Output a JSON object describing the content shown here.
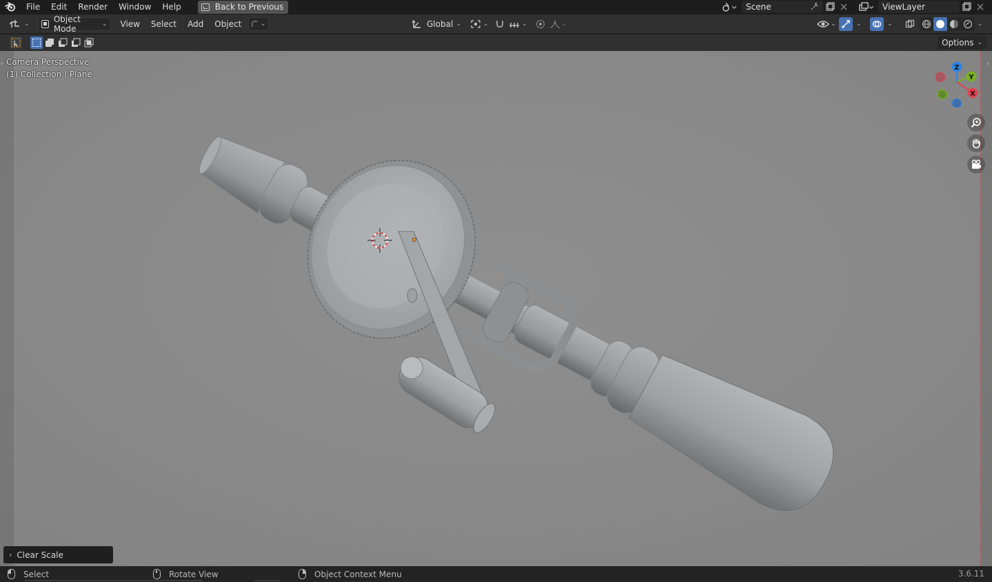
{
  "menubar": {
    "items": [
      "File",
      "Edit",
      "Render",
      "Window",
      "Help"
    ],
    "back_button": "Back to Previous",
    "scene": "Scene",
    "view_layer": "ViewLayer"
  },
  "header": {
    "mode": "Object Mode",
    "menus": [
      "View",
      "Select",
      "Add",
      "Object"
    ],
    "transform_orientation": "Global"
  },
  "toolbar": {
    "options_label": "Options"
  },
  "viewport": {
    "view_name": "Camera Perspective",
    "collection_info": "(1) Collection | Plane",
    "gizmo_axes": {
      "z": "Z",
      "y": "Y",
      "x": "X"
    },
    "last_operator": "Clear Scale",
    "colors": {
      "x_axis": "#e0454e",
      "y_axis": "#78b21e",
      "z_axis": "#2f84e3",
      "background": "#8c8c8c",
      "model": "#a8abae"
    }
  },
  "statusbar": {
    "left_mouse": "Select",
    "middle_mouse": "Rotate View",
    "right_mouse": "Object Context Menu",
    "version": "3.6.11"
  }
}
